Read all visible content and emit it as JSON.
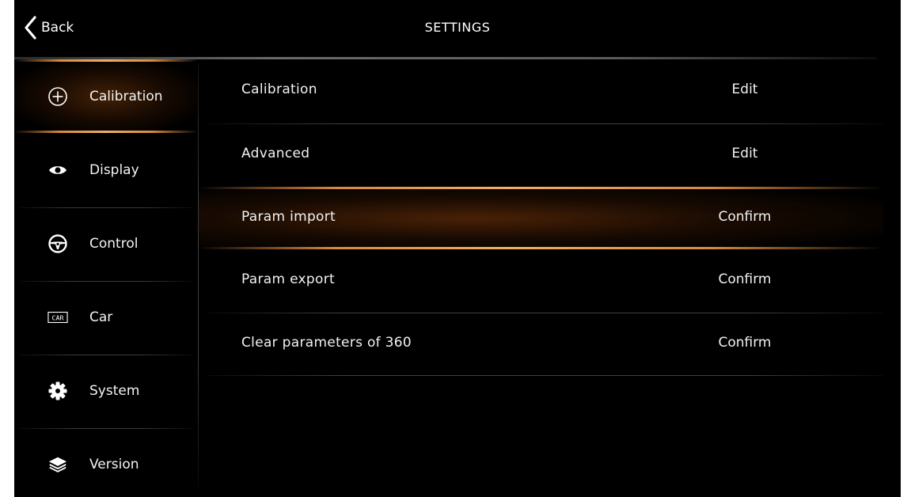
{
  "header": {
    "back_label": "Back",
    "title": "SETTINGS"
  },
  "sidebar": {
    "active": "Calibration",
    "items": [
      {
        "label": "Calibration",
        "icon": "plus-circle-icon"
      },
      {
        "label": "Display",
        "icon": "eye-icon"
      },
      {
        "label": "Control",
        "icon": "steering-wheel-icon"
      },
      {
        "label": "Car",
        "icon": "car-badge-icon",
        "icon_text": "CAR"
      },
      {
        "label": "System",
        "icon": "gear-icon"
      },
      {
        "label": "Version",
        "icon": "layers-icon"
      }
    ]
  },
  "main": {
    "active_row": "Param import",
    "rows": [
      {
        "label": "Calibration",
        "action": "Edit"
      },
      {
        "label": "Advanced",
        "action": "Edit"
      },
      {
        "label": "Param import",
        "action": "Confirm"
      },
      {
        "label": "Param export",
        "action": "Confirm"
      },
      {
        "label": "Clear parameters of 360",
        "action": "Confirm"
      }
    ]
  },
  "colors": {
    "background": "#000000",
    "text": "#ffffff",
    "accent_glow": "#f0b060"
  }
}
